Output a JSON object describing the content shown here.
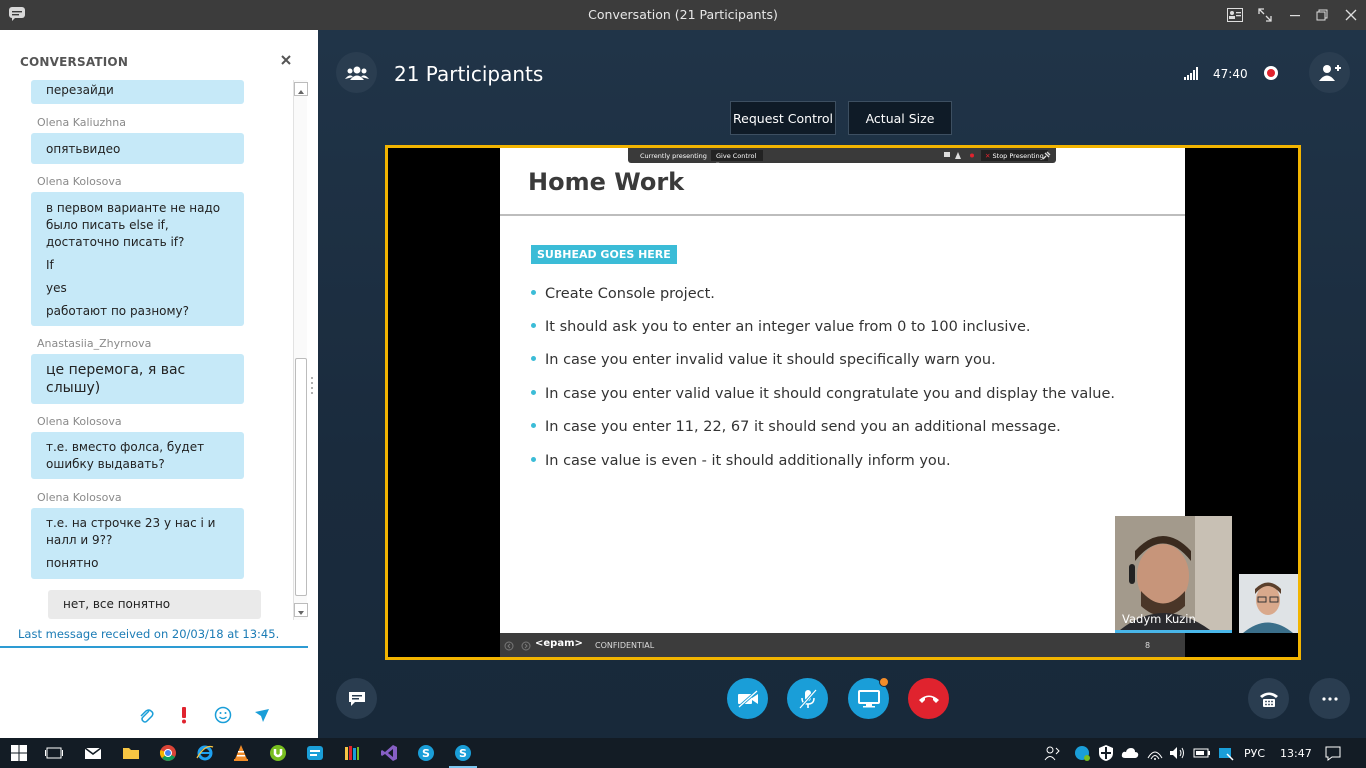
{
  "window": {
    "title": "Conversation (21 Participants)",
    "controls": [
      "contact-card-icon",
      "fullscreen-icon",
      "minimize-icon",
      "restore-icon",
      "close-icon"
    ]
  },
  "chat": {
    "header": "CONVERSATION",
    "messages": [
      {
        "sender": "",
        "lines": [
          "перезайди"
        ]
      },
      {
        "sender": "Olena Kaliuzhna",
        "lines": [
          "опятьвидео"
        ]
      },
      {
        "sender": "Olena Kolosova",
        "lines": [
          "в первом варианте не надо",
          "было писать else if,",
          "достаточно писать if?",
          "If",
          "yes",
          "работают по разному?"
        ]
      },
      {
        "sender": "Anastasiia_Zhyrnova",
        "lines": [
          "це перемога, я вас",
          "слышу)"
        ]
      },
      {
        "sender": "Olena Kolosova",
        "lines": [
          "т.е. вместо фолса, будет",
          "ошибку выдавать?"
        ]
      },
      {
        "sender": "Olena Kolosova",
        "lines": [
          "т.е. на строчке 23 у нас i и",
          "налл и 9??",
          "понятно"
        ]
      }
    ],
    "own_message": "нет, все понятно",
    "last_received": "Last message received on 20/03/18 at 13:45."
  },
  "call": {
    "title": "21 Participants",
    "duration": "47:40",
    "request_control": "Request Control",
    "actual_size": "Actual Size"
  },
  "presenter_bar": {
    "currently_presenting": "Currently presenting",
    "give_control": "Give Control",
    "stop_presenting": "Stop Presenting"
  },
  "slide": {
    "title": "Home Work",
    "subhead": "SUBHEAD GOES HERE",
    "bullets": [
      "Create Console project.",
      "It should ask you to enter an integer value from 0 to 100 inclusive.",
      "In case you enter invalid value it should specifically warn you.",
      "In case you enter valid value it should congratulate you and display the value.",
      "In case you enter 11, 22, 67  it should send you an additional message.",
      "In case value is even - it should additionally inform you."
    ],
    "footer_logo": "<epam>",
    "footer_label": "CONFIDENTIAL",
    "page_number": "8"
  },
  "video": {
    "main_name": "Vadym Kuzin"
  },
  "taskbar": {
    "language": "РУС",
    "time": "13:47"
  },
  "colors": {
    "accent_blue": "#1a9ed8",
    "end_call_red": "#e0232e",
    "bubble_blue": "#c6e9f8",
    "screen_border": "#f2b400"
  }
}
